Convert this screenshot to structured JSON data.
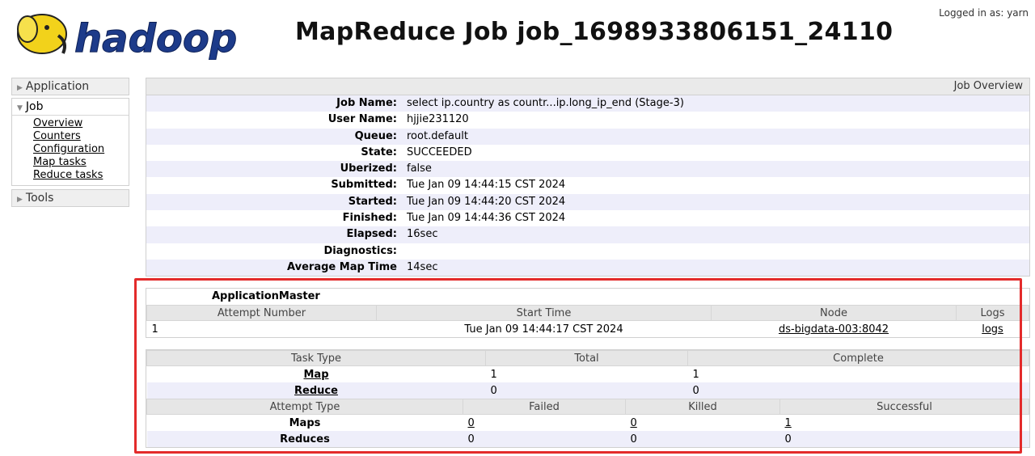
{
  "header": {
    "logo_text": "hadoop",
    "title": "MapReduce Job job_1698933806151_24110",
    "login_info": "Logged in as: yarn"
  },
  "nav": {
    "application": "Application",
    "job": "Job",
    "job_links": [
      "Overview",
      "Counters",
      "Configuration",
      "Map tasks",
      "Reduce tasks"
    ],
    "tools": "Tools"
  },
  "overview": {
    "heading": "Job Overview",
    "rows": [
      {
        "label": "Job Name:",
        "value": "select ip.country as countr...ip.long_ip_end (Stage-3)"
      },
      {
        "label": "User Name:",
        "value": "hjjie231120"
      },
      {
        "label": "Queue:",
        "value": "root.default"
      },
      {
        "label": "State:",
        "value": "SUCCEEDED"
      },
      {
        "label": "Uberized:",
        "value": "false"
      },
      {
        "label": "Submitted:",
        "value": "Tue Jan 09 14:44:15 CST 2024"
      },
      {
        "label": "Started:",
        "value": "Tue Jan 09 14:44:20 CST 2024"
      },
      {
        "label": "Finished:",
        "value": "Tue Jan 09 14:44:36 CST 2024"
      },
      {
        "label": "Elapsed:",
        "value": "16sec"
      },
      {
        "label": "Diagnostics:",
        "value": ""
      },
      {
        "label": "Average Map Time",
        "value": "14sec"
      }
    ]
  },
  "app_master": {
    "title": "ApplicationMaster",
    "headers": [
      "Attempt Number",
      "Start Time",
      "Node",
      "Logs"
    ],
    "row": {
      "attempt": "1",
      "start_time": "Tue Jan 09 14:44:17 CST 2024",
      "node": "ds-bigdata-003:8042",
      "logs": "logs"
    }
  },
  "tasks": {
    "headers": [
      "Task Type",
      "Total",
      "Complete"
    ],
    "rows": [
      {
        "type": "Map",
        "total": "1",
        "complete": "1"
      },
      {
        "type": "Reduce",
        "total": "0",
        "complete": "0"
      }
    ],
    "attempt_headers": [
      "Attempt Type",
      "Failed",
      "Killed",
      "Successful"
    ],
    "attempt_rows": [
      {
        "type": "Maps",
        "failed": "0",
        "killed": "0",
        "successful": "1"
      },
      {
        "type": "Reduces",
        "failed": "0",
        "killed": "0",
        "successful": "0"
      }
    ]
  },
  "colors": {
    "highlight": "#e32b2b",
    "stripe": "#eeeefa",
    "header_bg": "#e6e6e6"
  }
}
